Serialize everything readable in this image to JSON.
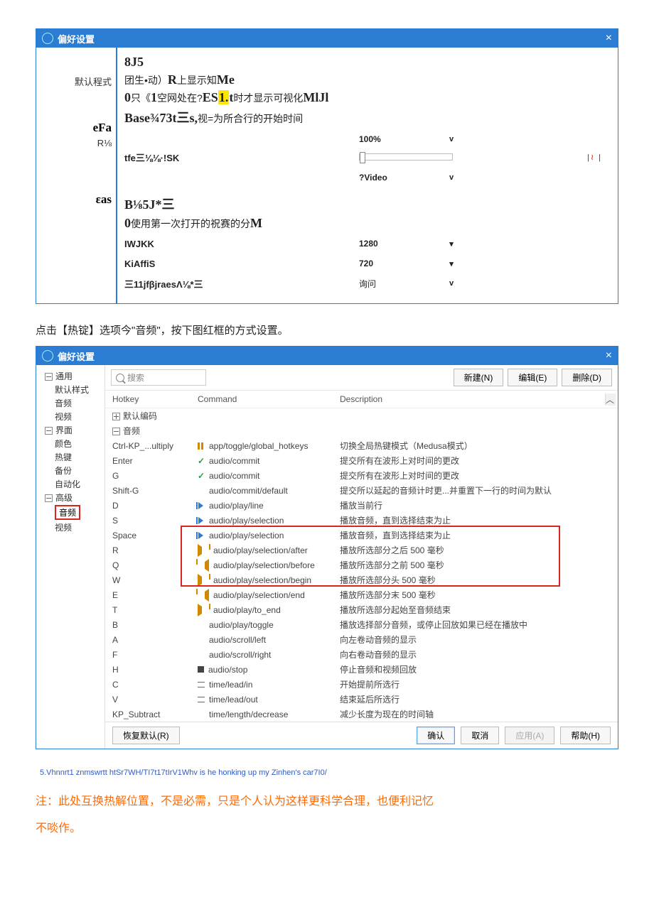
{
  "win1": {
    "title": "偏好设置",
    "left": {
      "l1": "默认程式",
      "l2": "eFa",
      "l3": "R⅛",
      "l4": "εas"
    },
    "r": {
      "a": "8J5",
      "b_pre": "团生•动）",
      "b_bold": "R",
      "b_post": "上显示知",
      "b_end": "Me",
      "c_pre": "0",
      "c_mid1": "只《",
      "c_bold1": "1",
      "c_mid2": "空网处在?",
      "c_bold2": "ES",
      "c_hl": "1.",
      "c_bold3": "t",
      "c_mid3": "时才显示可视化",
      "c_bold4": "MlJl",
      "d_bold": "Base¾73t三s,",
      "d_post": "视=为所合行的开始时间",
      "row1_val": "100%",
      "row1_drop": "v",
      "e_bold": "tfe三⅛⅛·!SK",
      "row2_val": "?Video",
      "row2_drop": "v",
      "f_bold": "B⅛5J*三",
      "g_pre": "0",
      "g_mid": "使用第一次打开的祝赛的分",
      "g_end": "M",
      "h_bold": "IWJKK",
      "row3_val": "1280",
      "i_bold": "KiAffiS",
      "row4_val": "720",
      "j_bold": "三11jfβjraesΛ⅛*三",
      "row5_val": "询问",
      "row5_drop": "v",
      "slider_red": "|≀ |"
    }
  },
  "instr": "点击【热锭】选项今\"音频\"，按下图红框的方式设置。",
  "win2": {
    "title": "偏好设置",
    "tree": {
      "n0": "通用",
      "n0a": "默认样式",
      "n1": "音频",
      "n2": "视频",
      "n3": "界面",
      "n3a": "颜色",
      "n3b": "热键",
      "n4": "备份",
      "n5": "自动化",
      "n6": "高级",
      "n6a": "音频",
      "n6b": "视频"
    },
    "search_ph": "搜索",
    "buttons": {
      "new": "新建(N)",
      "edit": "编辑(E)",
      "del": "删除(D)"
    },
    "head": {
      "h1": "Hotkey",
      "h2": "Command",
      "h3": "Description"
    },
    "groups": {
      "g1": "默认编码",
      "g2": "音频"
    },
    "rows": [
      {
        "k": "Ctrl-KP_...ultiply",
        "c": "app/toggle/global_hotkeys",
        "d": "切换全局热键模式（Medusa模式）",
        "ico": "pause"
      },
      {
        "k": "Enter",
        "c": "audio/commit",
        "d": "提交所有在波形上对时间的更改",
        "ico": "check"
      },
      {
        "k": "G",
        "c": "audio/commit",
        "d": "提交所有在波形上对时间的更改",
        "ico": "check"
      },
      {
        "k": "Shift-G",
        "c": "audio/commit/default",
        "d": "提交所以延起的音频计时更...并重置下一行的时间为默认",
        "ico": ""
      },
      {
        "k": "D",
        "c": "audio/play/line",
        "d": "播放当前行",
        "ico": "playbar"
      },
      {
        "k": "S",
        "c": "audio/play/selection",
        "d": "播放音频，直到选择结束为止",
        "ico": "playbar"
      },
      {
        "k": "Space",
        "c": "audio/play/selection",
        "d": "播放音频，直到选择结束为止",
        "ico": "playbar"
      },
      {
        "k": "R",
        "c": "audio/play/selection/after",
        "d": "播放所选部分之后 500 毫秒",
        "ico": "arrow-r"
      },
      {
        "k": "Q",
        "c": "audio/play/selection/before",
        "d": "播放所选部分之前 500 毫秒",
        "ico": "arrow-l"
      },
      {
        "k": "W",
        "c": "audio/play/selection/begin",
        "d": "播放所选部分头 500 毫秒",
        "ico": "arrow-r"
      },
      {
        "k": "E",
        "c": "audio/play/selection/end",
        "d": "播放所选部分末 500 毫秒",
        "ico": "arrow-l"
      },
      {
        "k": "T",
        "c": "audio/play/to_end",
        "d": "播放所选部分起始至音频结束",
        "ico": "arrow-r"
      },
      {
        "k": "B",
        "c": "audio/play/toggle",
        "d": "播放选择部分音频，或停止回放如果已经在播放中",
        "ico": ""
      },
      {
        "k": "A",
        "c": "audio/scroll/left",
        "d": "向左卷动音频的显示",
        "ico": ""
      },
      {
        "k": "F",
        "c": "audio/scroll/right",
        "d": "向右卷动音频的显示",
        "ico": ""
      },
      {
        "k": "H",
        "c": "audio/stop",
        "d": "停止音频和视频回放",
        "ico": "stop"
      },
      {
        "k": "C",
        "c": "time/lead/in",
        "d": "开始提前所选行",
        "ico": "lead"
      },
      {
        "k": "V",
        "c": "time/lead/out",
        "d": "结束延后所选行",
        "ico": "lead"
      },
      {
        "k": "KP_Subtract",
        "c": "time/length/decrease",
        "d": "减少长度为现在的时间轴",
        "ico": ""
      }
    ],
    "foot": {
      "restore": "恢复默认(R)",
      "ok": "确认",
      "cancel": "取消",
      "apply": "应用(A)",
      "help": "帮助(H)"
    },
    "leak": "5.Vhnnrt1 znmswrtt htSr7WH/TI7t17tIrV1Whv is he honking up my Zinhen's car7I0/"
  },
  "note1": "注：此处互换热解位置，不是必需，只是个人认为这样更科学合理，也便利记忆",
  "note2": "不啖作。"
}
